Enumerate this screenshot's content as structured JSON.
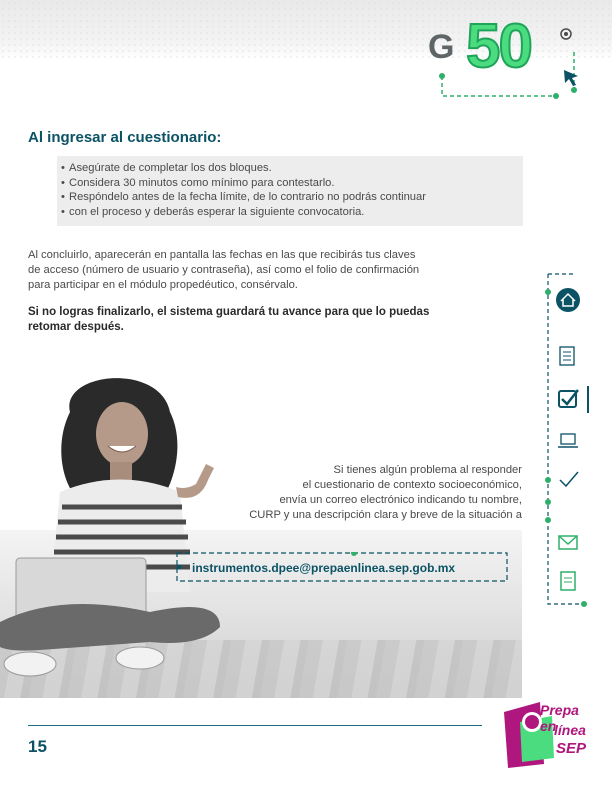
{
  "logo": {
    "letter": "G",
    "number": "50"
  },
  "section_title": "Al ingresar al cuestionario:",
  "bullets": [
    "Asegúrate de completar los dos bloques.",
    "Considera 30 minutos como mínimo para contestarlo.",
    "Respóndelo antes de la fecha límite, de lo contrario no podrás continuar",
    "con el proceso y deberás esperar la siguiente convocatoria."
  ],
  "paragraph": [
    "Al concluirlo, aparecerán en pantalla las fechas en las que recibirás tus claves",
    "de acceso (número de usuario y contraseña), así como el folio de confirmación",
    "para participar en el módulo propedéutico, consérvalo."
  ],
  "bold_paragraph": [
    "Si no logras finalizarlo, el sistema guardará tu avance para que lo puedas",
    "retomar después."
  ],
  "help_text": [
    "Si tienes algún problema al responder",
    "el cuestionario de contexto socioeconómico,",
    "envía un correo electrónico indicando tu nombre,",
    "CURP y una descripción clara y breve de la situación a"
  ],
  "email": "instrumentos.dpee@prepaenlinea.sep.gob.mx",
  "page_number": "15",
  "brand_logo": {
    "line1": "Prepa en",
    "line2": "línea",
    "line3": "SEP"
  },
  "colors": {
    "teal": "#0b5265",
    "green": "#4bdc7f",
    "accent_green": "#2eb06a",
    "magenta": "#b0177e"
  },
  "side_nav_icons": [
    "home-icon",
    "list-icon",
    "checkbox-icon",
    "laptop-icon",
    "checkmark-icon",
    "envelope-icon",
    "document-icon"
  ]
}
